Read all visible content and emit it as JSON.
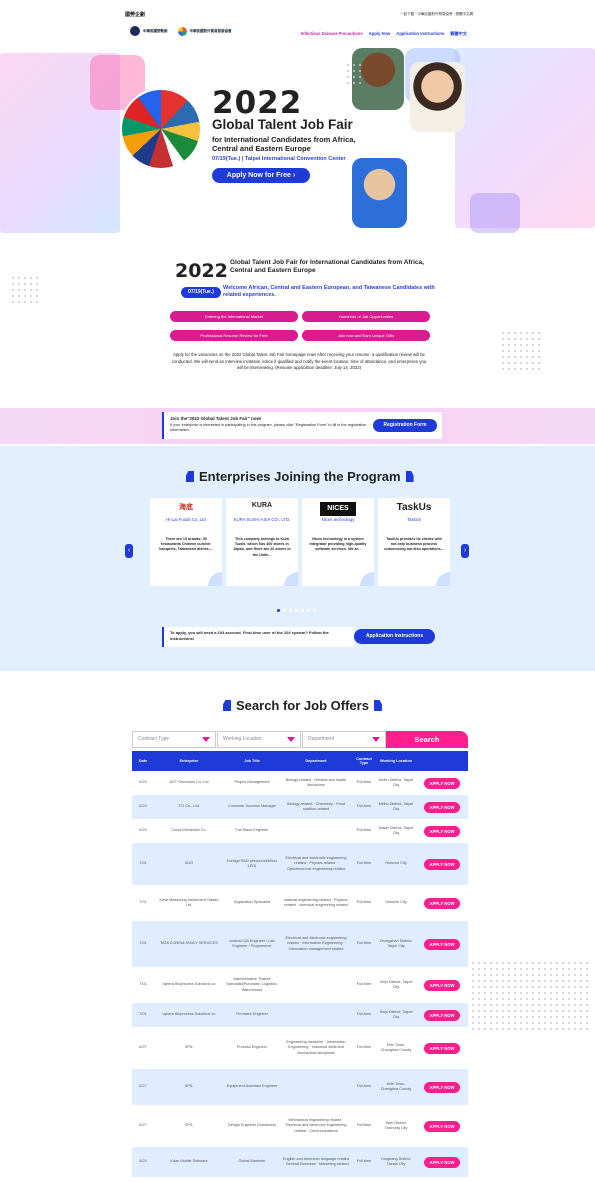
{
  "topbar": {
    "siteid": "國勞企劃",
    "links": "一起下載 · 中華民國對外貿易協會 · 簡體中文網"
  },
  "logos": [
    {
      "label": "中華民國勞動部"
    },
    {
      "label": "中華民國對外貿易發展協會"
    }
  ],
  "nav": [
    "Infectious Disease Precautions",
    "Apply Now",
    "Application Instructions",
    "繁體中文"
  ],
  "hero": {
    "year": "2022",
    "title": "Global Talent Job Fair",
    "subtitle": "for International Candidates from Africa, Central and Eastern Europe",
    "date": "07/19(Tue.) | Taipei International Convention Center",
    "apply": "Apply Now for Free  ›"
  },
  "intro": {
    "year": "2022",
    "title": "Global Talent Job Fair for International Candidates from Africa, Central and Eastern Europe",
    "badge": "07/19(Tue.)",
    "welcome": "Welcome African, Central and Eastern European, and Taiwanese Candidates with related experiences.",
    "pills": [
      "Entering the International Market",
      "Hundreds of Job Opportunities",
      "Professional Resume Review for Free",
      "Join now and Earn Unique Gifts"
    ],
    "para": "Apply for the vacancies on the 2022 Global Talent Job Fair homepage now! After receiving your resume, a qualification review will be conducted. We will send an interview invitation notice if qualified and notify the event location, time of attendance, and enterprises you will be interviewing. (Resume application deadline: July 14, 2022)"
  },
  "registration": {
    "title": "Join the\"2022 Global Talent Job Fair\" now!",
    "text": "If your enterprise is interested in participating in this program, please click \"Registration Form\" to fill in the registration information.",
    "button": "Registration Form"
  },
  "enterprises": {
    "title": "Enterprises Joining the Program",
    "cards": [
      {
        "logo": "海底",
        "name": "Hi-Lai Foods Co.,Ltd",
        "desc": "There are 19 brands; 49 restaurants Chinese cuisine: banquets, Taiwanese dishes,..."
      },
      {
        "logo": "KURA",
        "name": "KURA SUSHI ASIA CO., LTD.",
        "desc": "This company belongs to Kura Sushi, which has 400 stores in Japan, and there are 20 stores in the Unite..."
      },
      {
        "logo": "NICES",
        "name": "Nices technology",
        "desc": "Nices technology is a system integrator providing high-quality software services. We ar..."
      },
      {
        "logo": "TaskUs",
        "name": "TaskUs",
        "desc": "TaskUs provides its clients with not only business process outsourcing but also operations..."
      }
    ],
    "apply_text": "To apply, you will need a 104 account. First-time user of the 104 system? Follow the instructions!",
    "apply_button": "Application Instructions"
  },
  "jobs": {
    "title": "Search for Job Offers",
    "filters": [
      "Contract Type",
      "Working Location",
      "Department"
    ],
    "search": "Search",
    "headers": [
      "Date",
      "Enterprise",
      "Job Title",
      "Department",
      "Contract Type",
      "Working Location",
      ""
    ],
    "apply_label": "APPLY NOW",
    "rows": [
      [
        "6/24",
        "ACT Genomics Co. Ltd",
        "Project Management",
        "Biology-related · Medical and health disciplines",
        "Full-time",
        "Neihu District, Taipei City"
      ],
      [
        "6/24",
        "TCI Co., Ltd.",
        "Customer Success Manager",
        "Biology-related · Chemistry · Food nutrition-related",
        "Full-time",
        "Neihu District, Taipei City"
      ],
      [
        "6/24",
        "Cloud Interactive Co.",
        "Full Stack Engineer",
        "",
        "Full-time",
        "Datan District, Taipei City"
      ],
      [
        "7/01",
        "AUO",
        "Foreign R&D personnel(Micro LED)",
        "Electrical and electronic engineering related · Physics-related · Optoelectronic engineering related",
        "Full-time",
        "Hsinchu City"
      ],
      [
        "7/01",
        "Kinal Measuring Instrument Taiwan Ltd.",
        "Application Specialist",
        "material engineering related · Physics-related · chemical engineering related",
        "Full-time",
        "Hsinchu City"
      ],
      [
        "7/01",
        "TATA CONSULTANCY SERVICES",
        "Android QA Engineer / Lab Engineer / Programmer",
        "Electrical and electronic engineering related · Information Engineering · Information management related",
        "Full-time",
        "Zhongshan District, Taipei City"
      ],
      [
        "7/01",
        "cybera Bioprocess Solutions co",
        "Administrative Trainee Specialist(Purchase, Logistics, Warehouse)",
        "",
        "Full-time",
        "Xinyi District, Taipei City"
      ],
      [
        "7/01",
        "cybera Bioprocess Solutions co",
        "Firmware Engineer",
        "",
        "Full-time",
        "Xinyi District, Taipei City"
      ],
      [
        "6/27",
        "SPIL",
        "Process Engineer",
        "Engineering discipline · Information Engineering · Industrial skills and mechanical disciplines",
        "Full-time",
        "Erlin Town, Changhua County"
      ],
      [
        "6/27",
        "SPIL",
        "Equipment Assistant Engineer",
        "",
        "Full-time",
        "Erlin Town, Changhua County"
      ],
      [
        "6/27",
        "SPIL",
        "Design Engineer (Substrate)",
        "Mechanical engineering related · Electrical and electronic engineering related · Communications",
        "Full-time",
        "Tatzi District, Taichung City"
      ],
      [
        "6/24",
        "Kdan Mobile Software",
        "Global Marketer",
        "English and American language related · General Business · Marketing-related",
        "Full-time",
        "Yonghang District, Tainan City"
      ]
    ]
  }
}
